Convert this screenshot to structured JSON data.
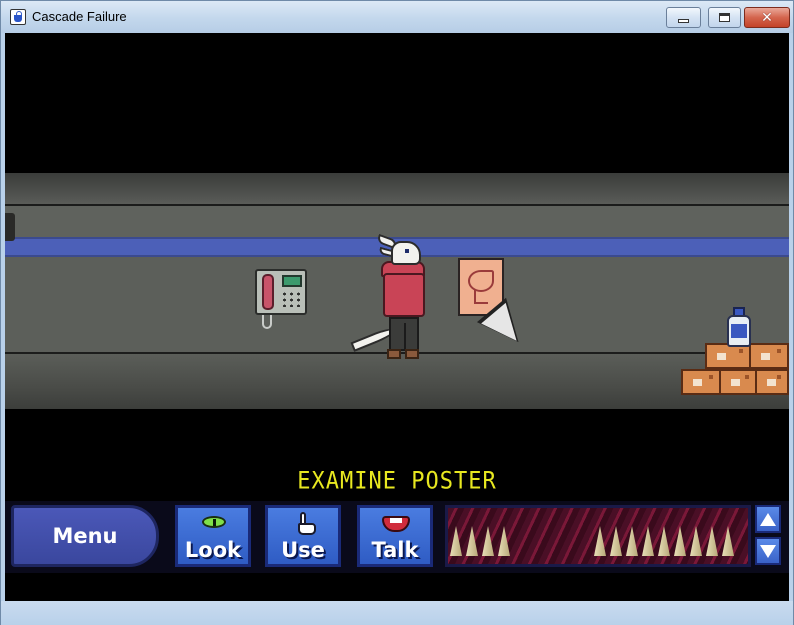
{
  "window": {
    "title": "Cascade Failure",
    "icon": "app-icon",
    "controls": [
      "minimize-icon",
      "maximize-icon",
      "close-icon"
    ]
  },
  "scene": {
    "status_text": "EXAMINE POSTER",
    "objects": [
      "payphone",
      "player-character",
      "poster",
      "cursor",
      "boxes",
      "bottle"
    ]
  },
  "action_bar": {
    "menu_label": "Menu",
    "verbs": [
      {
        "label": "Look",
        "icon": "eye-icon"
      },
      {
        "label": "Use",
        "icon": "hand-icon"
      },
      {
        "label": "Talk",
        "icon": "mouth-icon"
      }
    ],
    "inventory_icons": [
      "scroll-up-icon",
      "scroll-down-icon"
    ]
  },
  "colors": {
    "status_text": "#e8e820",
    "verb_button": "#2f5cc4",
    "menu_button": "#3a479e",
    "stripe": "#4c60b8"
  }
}
